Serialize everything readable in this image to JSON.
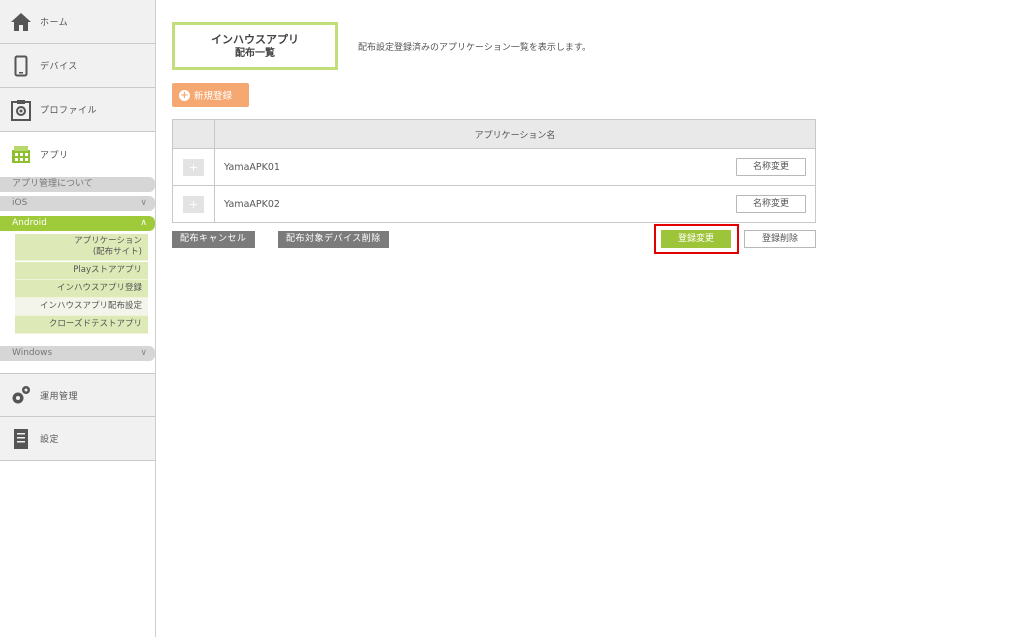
{
  "sidebar": {
    "nav": {
      "home": "ホーム",
      "device": "デバイス",
      "profile": "プロファイル",
      "app": "アプリ",
      "operation": "運用管理",
      "settings": "設定"
    },
    "app_about": "アプリ管理について",
    "ios": "iOS",
    "android": "Android",
    "windows": "Windows",
    "android_items": [
      {
        "line1": "アプリケーション",
        "line2": "(配布サイト)"
      },
      {
        "label": "Playストアアプリ"
      },
      {
        "label": "インハウスアプリ登録"
      },
      {
        "label": "インハウスアプリ配布設定"
      },
      {
        "label": "クローズドテストアプリ"
      }
    ]
  },
  "page": {
    "title_line1": "インハウスアプリ",
    "title_line2": "配布一覧",
    "description": "配布設定登録済みのアプリケーション一覧を表示します。",
    "new_button": "新規登録"
  },
  "table": {
    "header": "アプリケーション名",
    "rows": [
      {
        "name": "YamaAPK01",
        "rename": "名称変更"
      },
      {
        "name": "YamaAPK02",
        "rename": "名称変更"
      }
    ]
  },
  "actions": {
    "cancel_distribution": "配布キャンセル",
    "delete_target_devices": "配布対象デバイス削除",
    "change_registration": "登録変更",
    "delete_registration": "登録削除"
  },
  "colors": {
    "accent_green": "#9ec43a",
    "orange": "#f6a873",
    "highlight_red": "#e30000"
  }
}
